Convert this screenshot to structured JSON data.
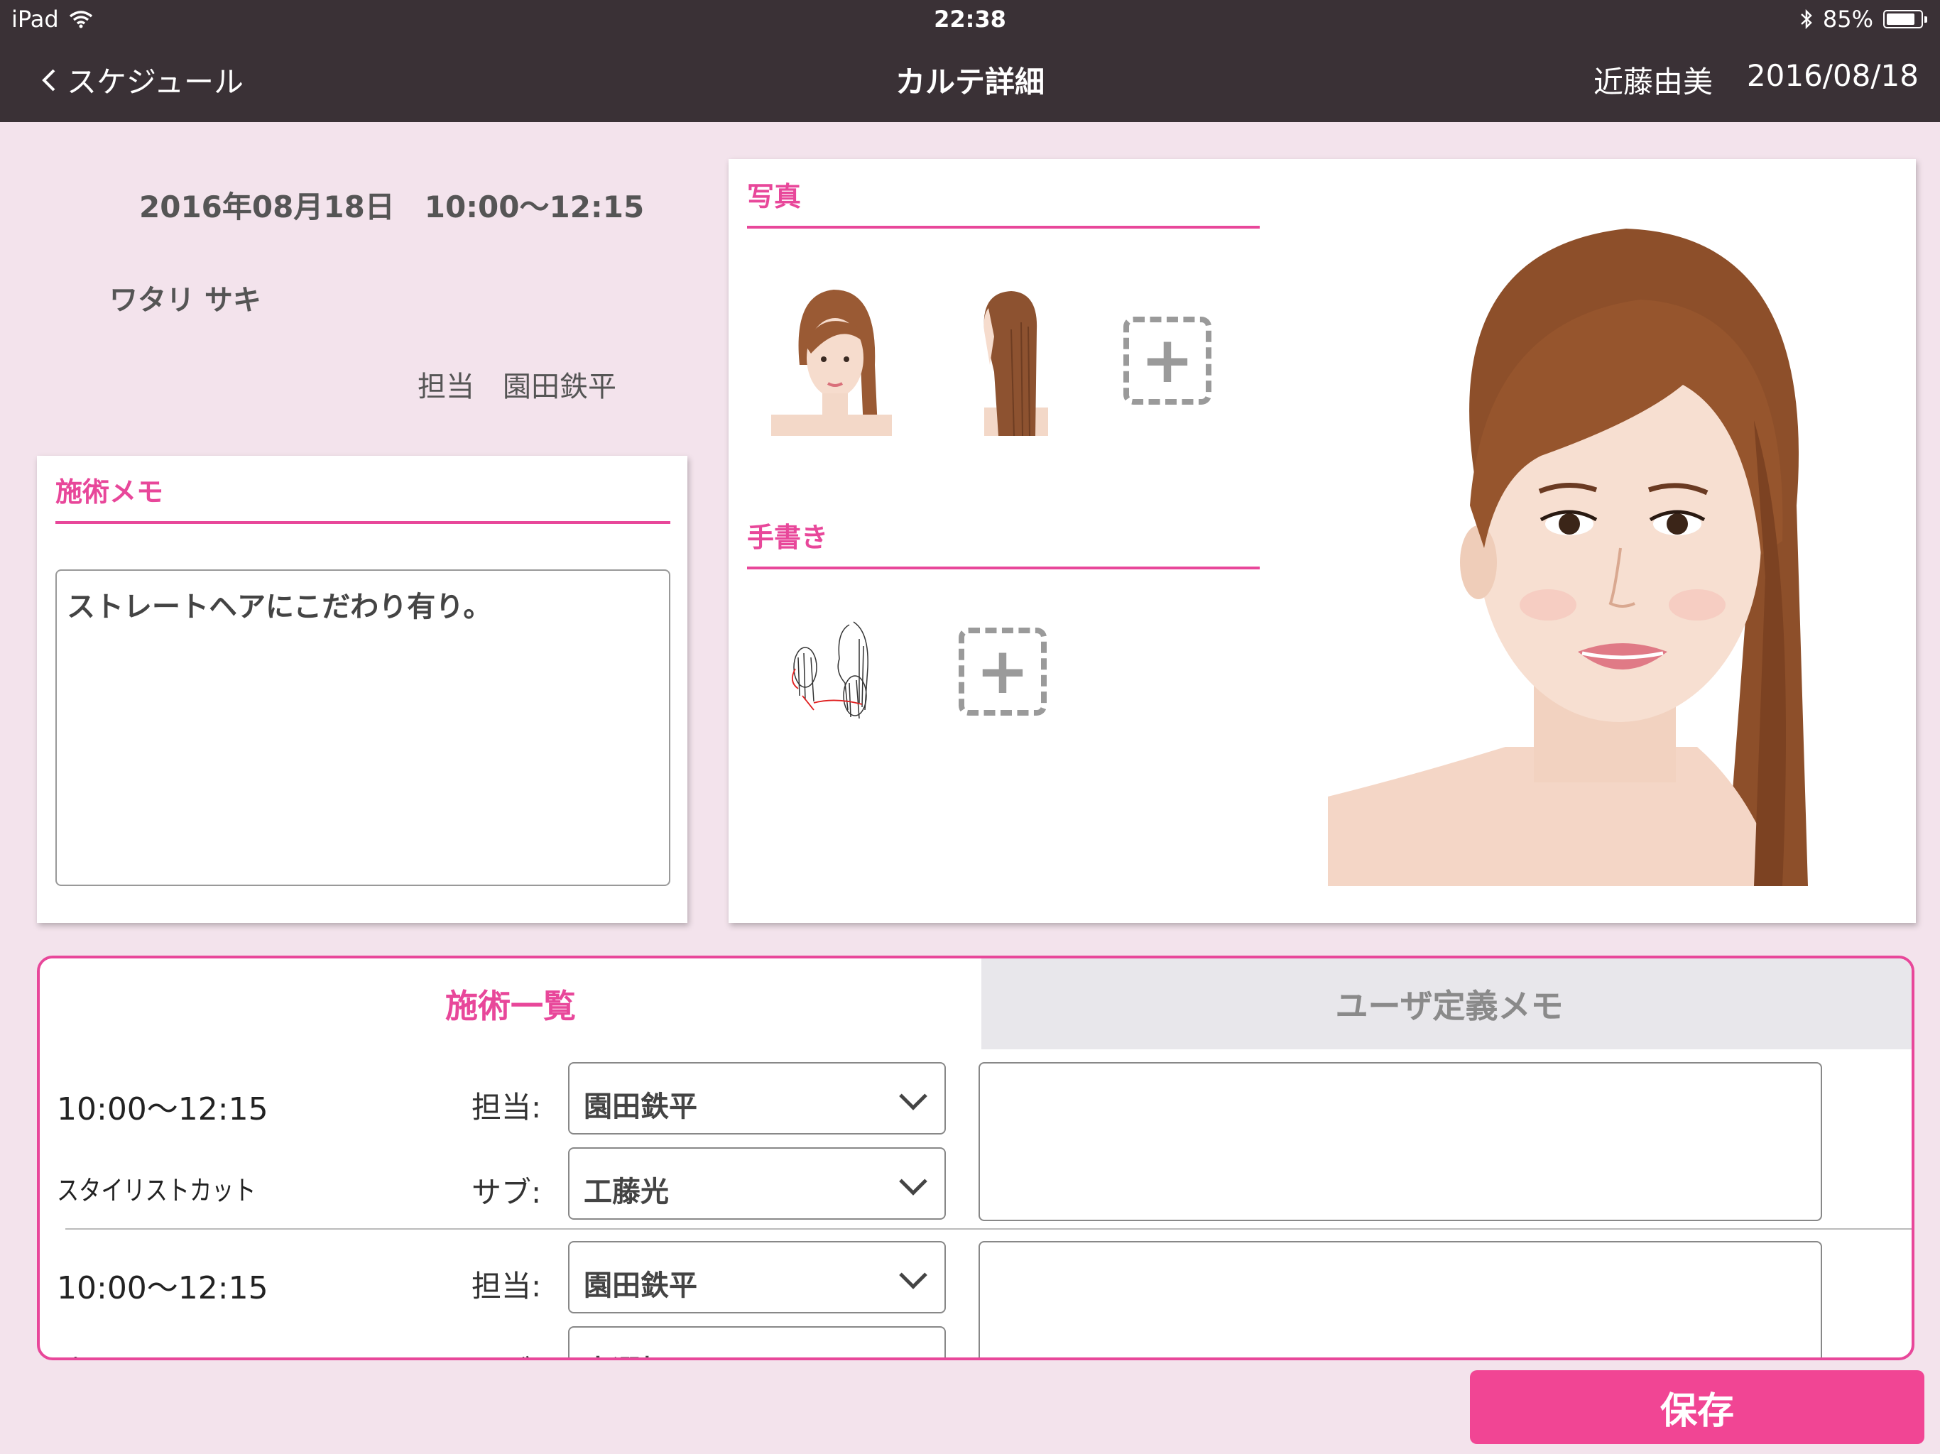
{
  "status_bar": {
    "device": "iPad",
    "time": "22:38",
    "battery": "85%",
    "battery_level": 0.85
  },
  "nav": {
    "back_label": "スケジュール",
    "title": "カルテ詳細",
    "user": "近藤由美",
    "date": "2016/08/18"
  },
  "appointment": {
    "datetime": "2016年08月18日　10:00〜12:15",
    "customer_name": "ワタリ サキ",
    "staff_label": "担当",
    "staff_name": "園田鉄平"
  },
  "memo": {
    "title": "施術メモ",
    "text": "ストレートヘアにこだわり有り。"
  },
  "photos": {
    "title": "写真",
    "handwriting_title": "手書き"
  },
  "tabs": [
    {
      "label": "施術一覧"
    },
    {
      "label": "ユーザ定義メモ"
    }
  ],
  "treatments": [
    {
      "time": "10:00〜12:15",
      "menu": "スタイリストカット",
      "main_label": "担当:",
      "main_staff": "園田鉄平",
      "sub_label": "サブ:",
      "sub_staff": "工藤光"
    },
    {
      "time": "10:00〜12:15",
      "menu": "パーマ",
      "main_label": "担当:",
      "main_staff": "園田鉄平",
      "sub_label": "サブ:",
      "sub_staff": "未選択"
    }
  ],
  "save_label": "保存",
  "colors": {
    "accent": "#e8479a",
    "header_bg": "#3a3136",
    "page_bg": "#f3e3ec",
    "save_button": "#f14594"
  }
}
